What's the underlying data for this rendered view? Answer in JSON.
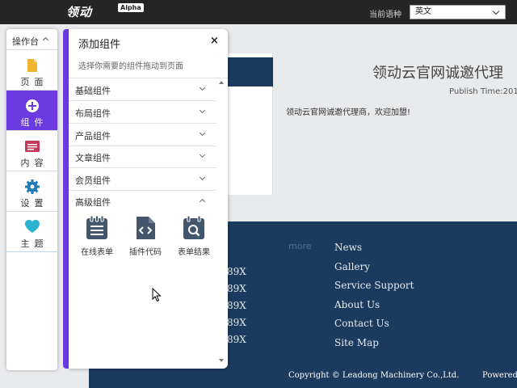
{
  "topbar": {
    "logo_text": "领动",
    "logo_badge": "Alpha",
    "language_label": "当前语种",
    "language_value": "英文"
  },
  "toolbar": {
    "header": "操作台",
    "items": [
      {
        "label": "页面",
        "icon": "page-icon"
      },
      {
        "label": "组件",
        "icon": "plus-circle-icon",
        "active": true
      },
      {
        "label": "内容",
        "icon": "content-icon"
      },
      {
        "label": "设置",
        "icon": "gear-icon"
      },
      {
        "label": "主题",
        "icon": "heart-icon"
      }
    ]
  },
  "panel": {
    "title": "添加组件",
    "close": "×",
    "subtitle": "选择你需要的组件拖动到页面",
    "categories": [
      {
        "label": "基础组件",
        "expanded": false
      },
      {
        "label": "布局组件",
        "expanded": false
      },
      {
        "label": "产品组件",
        "expanded": false
      },
      {
        "label": "文章组件",
        "expanded": false
      },
      {
        "label": "会员组件",
        "expanded": false
      },
      {
        "label": "高级组件",
        "expanded": true
      }
    ],
    "widgets": [
      {
        "label": "在线表单",
        "icon": "online-form-icon"
      },
      {
        "label": "插件代码",
        "icon": "plugin-code-icon"
      },
      {
        "label": "表单结果",
        "icon": "form-result-icon"
      }
    ]
  },
  "preview": {
    "headline": "领动云官网诚邀代理",
    "publish": "Publish Time:201",
    "text": "领动云官网诚邀代理商，欢迎加盟!",
    "footer_more": "more",
    "footer_numbers": [
      "89X",
      "89X",
      "89X",
      "89X",
      "89X"
    ],
    "footer_links": [
      "News",
      "Gallery",
      "Service Support",
      "About Us",
      "Contact Us",
      "Site Map"
    ],
    "copyright": "Copyright © Leadong Machinery Co.,Ltd.",
    "powered": "Powered"
  },
  "colors": {
    "accent": "#6a3be0",
    "footer": "#1b3b5e",
    "topbar": "#252525"
  }
}
